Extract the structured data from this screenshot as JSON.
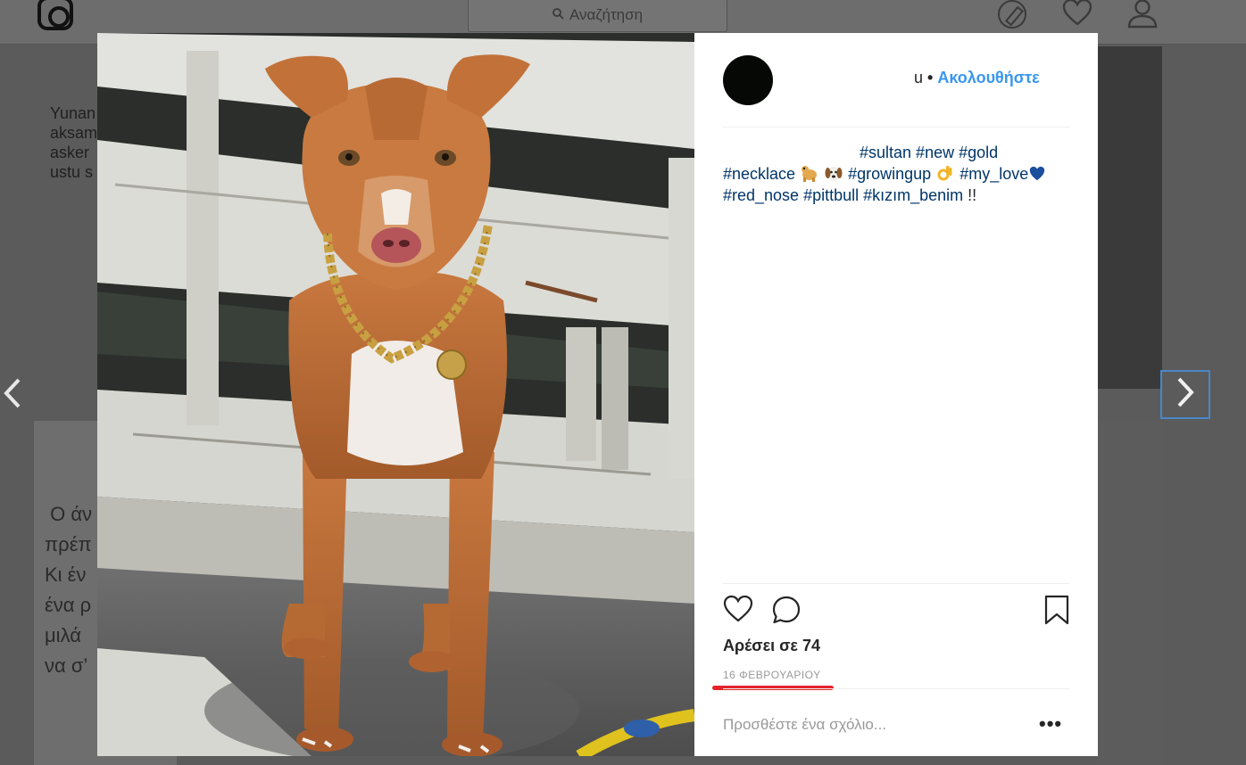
{
  "topbar": {
    "search_placeholder": "Αναζήτηση",
    "icons": [
      "instagram-logo-icon",
      "search-icon",
      "compass-icon",
      "heart-icon",
      "person-icon"
    ]
  },
  "background": {
    "feed_text_top": "Yunan\naksam\nasker\nustu s",
    "feed_text_left": " Ο άν\nπρέπ\nΚι έν\nένα ρ\nμιλά\nνα σ’"
  },
  "nav": {
    "prev_icon": "chevron-left-icon",
    "next_icon": "chevron-right-icon"
  },
  "post": {
    "username_visible": "u",
    "separator": "•",
    "follow_label": "Ακολουθήστε",
    "caption": {
      "line1": "#sultan #new #gold",
      "line2_a": "#necklace",
      "line2_b": "#growingup",
      "line2_c": "#my_love",
      "line3": "#red_nose #pittbull #kızım_benim",
      "suffix": " !!"
    },
    "emojis": [
      "dog-emoji",
      "dog-face-emoji",
      "ok-hand-emoji",
      "blue-heart-emoji"
    ],
    "likes": "Αρέσει σε 74",
    "date": "16 ΦΕΒΡΟΥΑΡΙΟΥ",
    "comment_placeholder": "Προσθέστε ένα σχόλιο...",
    "more_label": "•••"
  },
  "colors": {
    "accent": "#3897f0",
    "hashtag": "#003569",
    "highlight": "#e3242b",
    "overlay": "#5b5b5b",
    "next_border": "#4a86c6"
  }
}
